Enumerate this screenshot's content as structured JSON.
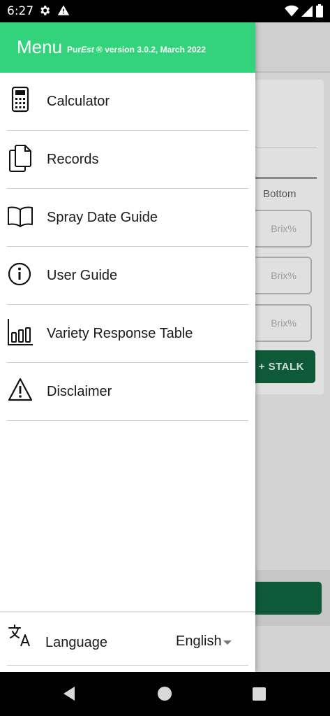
{
  "status_bar": {
    "time": "6:27",
    "icons": [
      "gear-icon",
      "alert-icon",
      "wifi-icon",
      "signal-icon",
      "battery-icon"
    ]
  },
  "background_app": {
    "column_label": "Bottom",
    "brix_placeholder": "Brix%",
    "add_stalk_label": "+ STALK",
    "accent_color": "#0e5a38"
  },
  "drawer": {
    "title": "Menu",
    "version_prefix": "Pur",
    "version_em": "Est",
    "version_suffix": " ® version 3.0.2, March 2022",
    "header_color": "#33d37b",
    "items": [
      {
        "label": "Calculator",
        "icon": "calculator-icon"
      },
      {
        "label": "Records",
        "icon": "documents-icon"
      },
      {
        "label": "Spray Date Guide",
        "icon": "book-icon"
      },
      {
        "label": "User Guide",
        "icon": "info-icon"
      },
      {
        "label": "Variety Response Table",
        "icon": "bar-chart-icon"
      },
      {
        "label": "Disclaimer",
        "icon": "warning-icon"
      }
    ],
    "language": {
      "label": "Language",
      "selected": "English",
      "icon": "translate-icon"
    }
  },
  "nav_bar": {
    "icons": [
      "back-icon",
      "home-icon",
      "recents-icon"
    ]
  }
}
